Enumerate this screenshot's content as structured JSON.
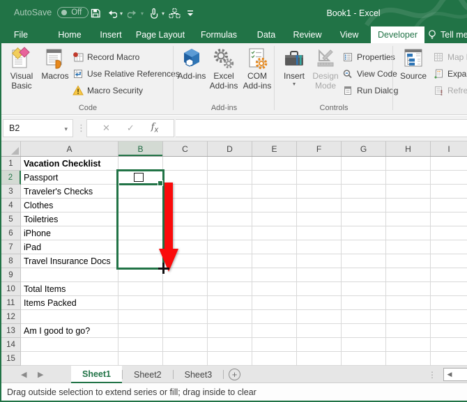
{
  "title_bar": {
    "autosave_label": "AutoSave",
    "autosave_state": "Off",
    "title": "Book1 - Excel"
  },
  "ribbon_tabs": {
    "file": "File",
    "home": "Home",
    "insert": "Insert",
    "page_layout": "Page Layout",
    "formulas": "Formulas",
    "data": "Data",
    "review": "Review",
    "view": "View",
    "developer": "Developer",
    "tell_me": "Tell me what you want to do"
  },
  "ribbon": {
    "code_group": {
      "label": "Code",
      "visual_basic": "Visual Basic",
      "macros": "Macros",
      "record_macro": "Record Macro",
      "use_relative_references": "Use Relative References",
      "macro_security": "Macro Security"
    },
    "addins_group": {
      "label": "Add-ins",
      "addins": "Add-ins",
      "excel_addins": "Excel Add-ins",
      "com_addins": "COM Add-ins"
    },
    "controls_group": {
      "label": "Controls",
      "insert": "Insert",
      "design_mode": "Design Mode",
      "properties": "Properties",
      "view_code": "View Code",
      "run_dialog": "Run Dialog"
    },
    "xml_group": {
      "source": "Source",
      "map_properties": "Map Properties",
      "expansion_packs": "Expansion Packs",
      "refresh_data": "Refresh Data"
    }
  },
  "formula_bar": {
    "name_box": "B2",
    "formula": ""
  },
  "grid": {
    "columns": [
      "A",
      "B",
      "C",
      "D",
      "E",
      "F",
      "G",
      "H",
      "I"
    ],
    "active_cell": "B2",
    "rows": [
      {
        "n": "1",
        "a": "Vacation Checklist"
      },
      {
        "n": "2",
        "a": "Passport"
      },
      {
        "n": "3",
        "a": "Traveler's Checks"
      },
      {
        "n": "4",
        "a": "Clothes"
      },
      {
        "n": "5",
        "a": "Toiletries"
      },
      {
        "n": "6",
        "a": "iPhone"
      },
      {
        "n": "7",
        "a": "iPad"
      },
      {
        "n": "8",
        "a": "Travel Insurance Docs"
      },
      {
        "n": "9",
        "a": ""
      },
      {
        "n": "10",
        "a": "Total Items"
      },
      {
        "n": "11",
        "a": "Items Packed"
      },
      {
        "n": "12",
        "a": ""
      },
      {
        "n": "13",
        "a": "Am I good to go?"
      },
      {
        "n": "14",
        "a": ""
      },
      {
        "n": "15",
        "a": ""
      }
    ]
  },
  "sheet_bar": {
    "sheet1": "Sheet1",
    "sheet2": "Sheet2",
    "sheet3": "Sheet3"
  },
  "status_bar": {
    "message": "Drag outside selection to extend series or fill; drag inside to clear"
  },
  "colors": {
    "excel_green": "#217346",
    "selection_green": "#217346",
    "arrow_red": "#FA0B0B",
    "ribbon_bg": "#F1F1F1",
    "header_bg": "#E6E6E6",
    "selected_header_bg": "#D3DAD3",
    "gridline": "#D9D9D9"
  }
}
